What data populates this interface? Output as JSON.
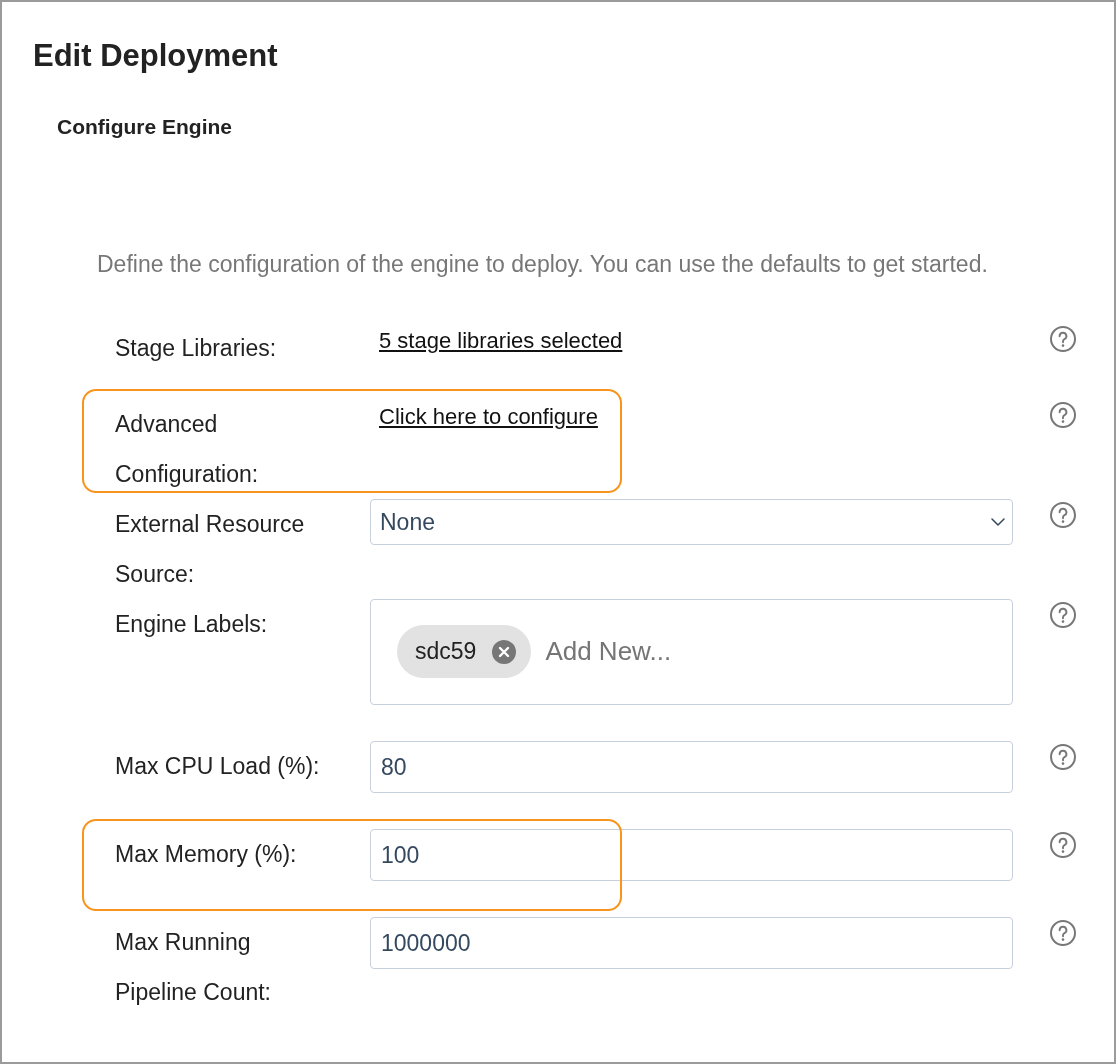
{
  "title": "Edit Deployment",
  "section": {
    "heading": "Configure Engine",
    "description": "Define the configuration of the engine to deploy. You can use the defaults to get started."
  },
  "fields": [
    {
      "kind": "link",
      "label": "Stage Libraries:",
      "value": "5 stage libraries selected",
      "highlighted": false
    },
    {
      "kind": "link",
      "label": "Advanced Configuration:",
      "value": "Click here to configure",
      "highlighted": true
    },
    {
      "kind": "select",
      "label": "External Resource Source:",
      "value": "None",
      "highlighted": false
    },
    {
      "kind": "tags",
      "label": "Engine Labels:",
      "tags": [
        "sdc59"
      ],
      "placeholder": "Add New...",
      "highlighted": false
    },
    {
      "kind": "input",
      "label": "Max CPU Load (%):",
      "value": "80",
      "highlighted": false
    },
    {
      "kind": "input",
      "label": "Max Memory (%):",
      "value": "100",
      "highlighted": true
    },
    {
      "kind": "input",
      "label": "Max Running Pipeline Count:",
      "value": "1000000",
      "highlighted": false
    }
  ]
}
